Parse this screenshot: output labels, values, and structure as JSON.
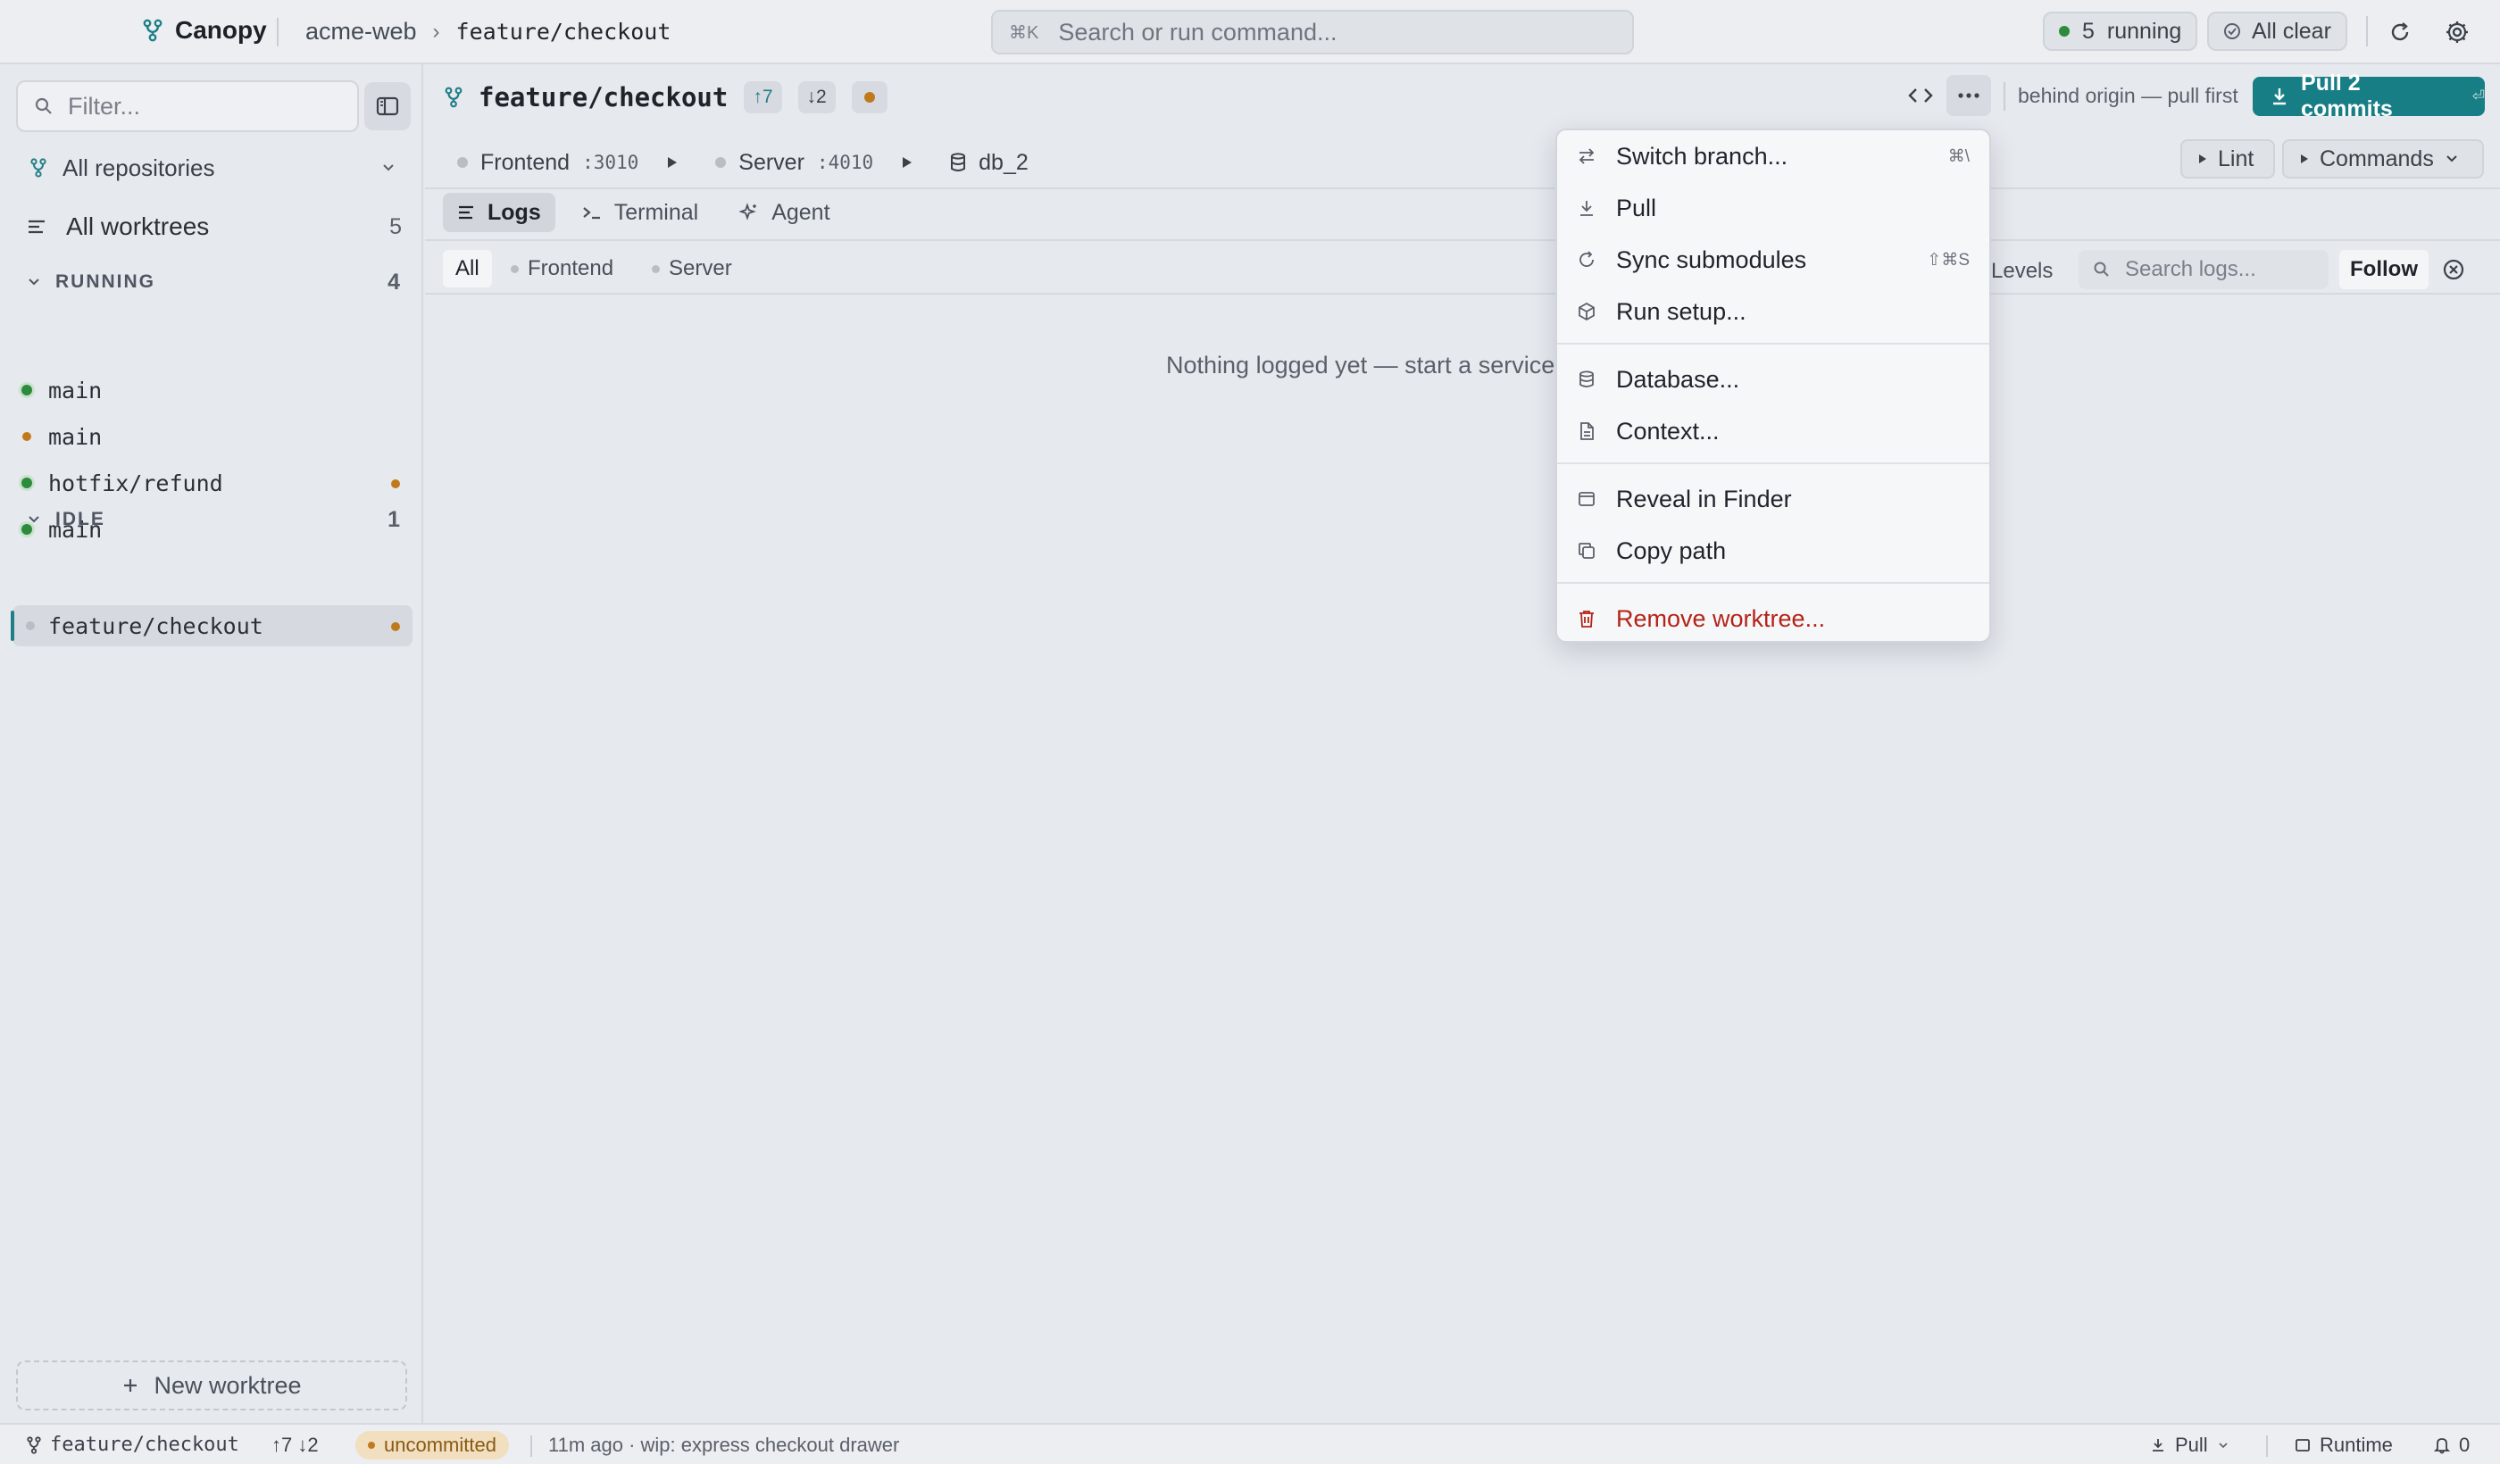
{
  "app": {
    "name": "Canopy"
  },
  "breadcrumb": {
    "repo": "acme-web",
    "separator": "›",
    "branch": "feature/checkout"
  },
  "command_bar": {
    "shortcut": "⌘K",
    "placeholder": "Search or run command..."
  },
  "status_pills": {
    "running_count": "5",
    "running_label": "running",
    "clear_label": "All clear"
  },
  "colors": {
    "accent": "#177e86",
    "running": "#2e8b3d",
    "modified": "#c07a1c",
    "danger": "#b42318",
    "idle": "#b9bec6"
  },
  "sidebar": {
    "filter_placeholder": "Filter...",
    "repo_select": "All repositories",
    "all_worktrees": {
      "label": "All worktrees",
      "count": "5"
    },
    "groups": [
      {
        "label": "RUNNING",
        "count": "4",
        "items": [
          {
            "label": "main",
            "status": "running",
            "modified": false
          },
          {
            "label": "main",
            "status": "modified",
            "modified": false
          },
          {
            "label": "hotfix/refund",
            "status": "running",
            "modified": true
          },
          {
            "label": "main",
            "status": "running",
            "modified": false
          }
        ]
      },
      {
        "label": "IDLE",
        "count": "1",
        "items": [
          {
            "label": "feature/checkout",
            "status": "idle",
            "modified": true,
            "selected": true
          }
        ]
      }
    ],
    "new_worktree": "New worktree"
  },
  "header": {
    "branch": "feature/checkout",
    "ahead": "↑7",
    "behind": "↓2",
    "behind_note": "behind origin — pull first",
    "pull_button": "Pull 2 commits",
    "pull_enter": "⏎"
  },
  "services": [
    {
      "name": "Frontend",
      "port": ":3010"
    },
    {
      "name": "Server",
      "port": ":4010"
    }
  ],
  "database": "db_2",
  "actions": {
    "lint": "Lint",
    "commands": "Commands"
  },
  "tabs": [
    {
      "label": "Logs",
      "active": true,
      "icon": "logs-icon"
    },
    {
      "label": "Terminal",
      "active": false,
      "icon": "terminal-icon"
    },
    {
      "label": "Agent",
      "active": false,
      "icon": "sparkle-icon"
    }
  ],
  "log_filters": {
    "all": "All",
    "frontend": "Frontend",
    "server": "Server",
    "levels": "Levels",
    "search_placeholder": "Search logs...",
    "follow": "Follow"
  },
  "empty_state": "Nothing logged yet — start a service",
  "menu": {
    "items": [
      {
        "label": "Switch branch...",
        "shortcut": "⌘\\",
        "icon": "switch-icon"
      },
      {
        "label": "Pull",
        "shortcut": "",
        "icon": "download-icon"
      },
      {
        "label": "Sync submodules",
        "shortcut": "⇧⌘S",
        "icon": "sync-icon"
      },
      {
        "label": "Run setup...",
        "shortcut": "",
        "icon": "package-icon"
      },
      {
        "label": "Database...",
        "shortcut": "",
        "icon": "database-icon"
      },
      {
        "label": "Context...",
        "shortcut": "",
        "icon": "document-icon"
      },
      {
        "label": "Reveal in Finder",
        "shortcut": "",
        "icon": "window-icon"
      },
      {
        "label": "Copy path",
        "shortcut": "",
        "icon": "copy-icon"
      },
      {
        "label": "Remove worktree...",
        "shortcut": "",
        "icon": "trash-icon"
      }
    ]
  },
  "statusbar": {
    "branch": "feature/checkout",
    "ahead_behind": "↑7 ↓2",
    "uncommitted": "uncommitted",
    "last_commit": "11m ago · wip: express checkout drawer",
    "pull": "Pull",
    "runtime": "Runtime",
    "notifications": "0"
  }
}
